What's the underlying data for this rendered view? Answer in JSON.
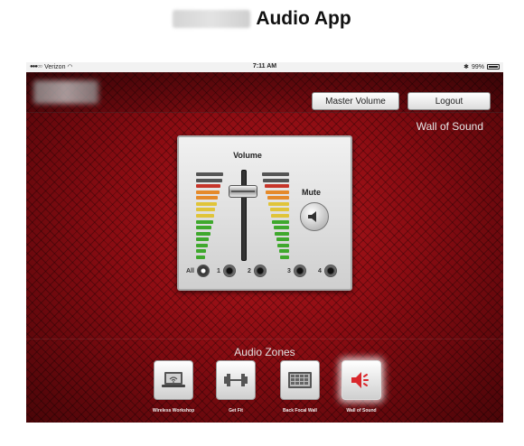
{
  "doc": {
    "title": "Audio App"
  },
  "status_bar": {
    "carrier": "Verizon",
    "time": "7:11 AM",
    "battery": "99%"
  },
  "header": {
    "master_volume_label": "Master Volume",
    "logout_label": "Logout",
    "zone_title": "Wall of Sound"
  },
  "panel": {
    "volume_label": "Volume",
    "mute_label": "Mute",
    "volume_level": 0.82,
    "outputs": [
      {
        "label": "All",
        "active": true
      },
      {
        "label": "1",
        "active": false
      },
      {
        "label": "2",
        "active": false
      },
      {
        "label": "3",
        "active": false
      },
      {
        "label": "4",
        "active": false
      }
    ]
  },
  "zones": {
    "label": "Audio Zones",
    "items": [
      {
        "name": "Wireless Workshop",
        "icon": "laptop-wifi-icon",
        "selected": false
      },
      {
        "name": "Get Fit",
        "icon": "dumbbell-icon",
        "selected": false
      },
      {
        "name": "Back Focal Wall",
        "icon": "video-wall-icon",
        "selected": false
      },
      {
        "name": "Wall of Sound",
        "icon": "speaker-icon",
        "selected": true
      }
    ]
  },
  "colors": {
    "meter_green": "#3fa82d",
    "meter_yellow": "#e0c43a",
    "meter_orange": "#e58a2a",
    "meter_red": "#c6352a",
    "meter_top": "#555555",
    "selected_zone_icon": "#d9262b"
  }
}
